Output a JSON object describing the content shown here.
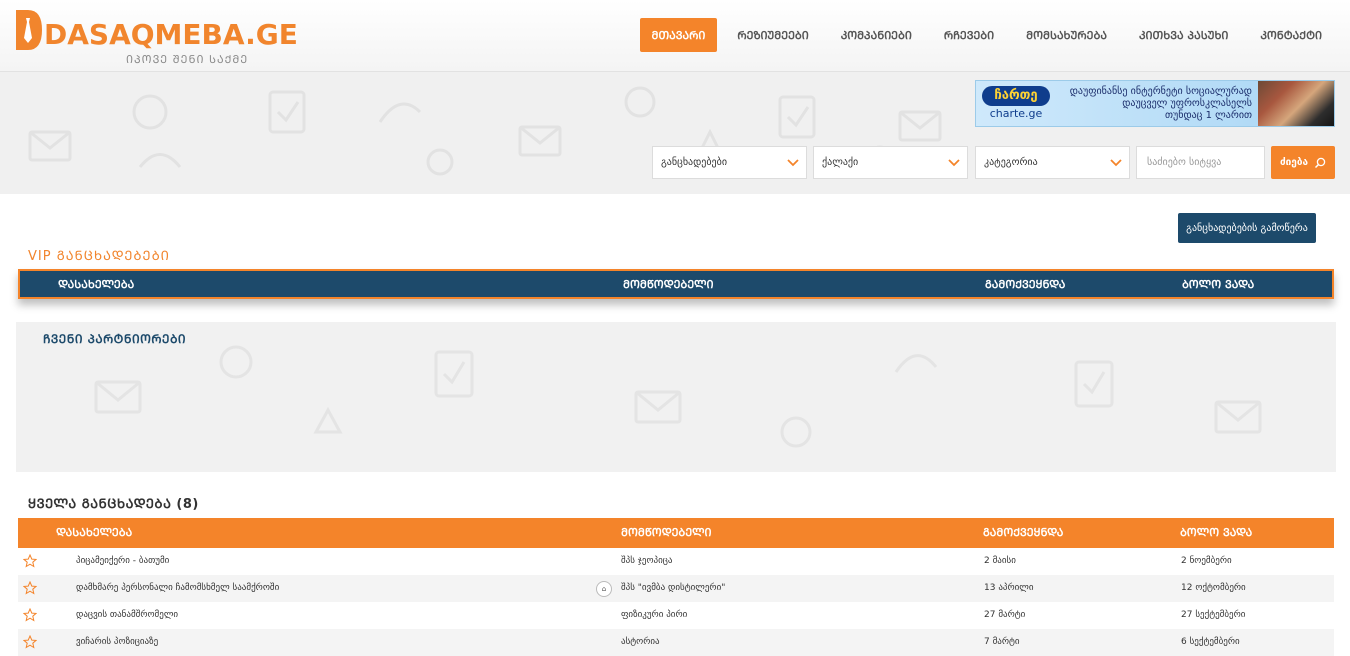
{
  "header": {
    "logo_text": "DASAQMEBA.GE",
    "logo_tagline": "ᲘᲞᲝᲕᲔ ᲨᲔᲜᲘ ᲡᲐᲥᲛᲔ",
    "nav": [
      {
        "label": "ᲛᲗᲐᲕᲐᲠᲘ",
        "active": true
      },
      {
        "label": "ᲠᲔᲖᲘᲣᲛᲔᲔᲑᲘ",
        "active": false
      },
      {
        "label": "ᲙᲝᲛᲞᲐᲜᲘᲔᲑᲘ",
        "active": false
      },
      {
        "label": "ᲠᲩᲔᲕᲔᲑᲘ",
        "active": false
      },
      {
        "label": "ᲛᲝᲛᲡᲐᲮᲣᲠᲔᲑᲐ",
        "active": false
      },
      {
        "label": "ᲙᲘᲗᲮᲕᲐ ᲞᲐᲡᲣᲮᲘ",
        "active": false
      },
      {
        "label": "ᲙᲝᲜᲢᲐᲥᲢᲘ",
        "active": false
      }
    ]
  },
  "banner": {
    "brand": "ჩართე",
    "url": "charte.ge",
    "line1": "დაუფინანსე ინტერნეტი სოციალურად",
    "line2": "დაუცველ უფროსკლასელს",
    "line3": "თუნდაც 1 ლარით"
  },
  "search": {
    "type_select": "განცხადებები",
    "city_select": "ქალაქი",
    "category_select": "კატეგორია",
    "keyword_placeholder": "საძიებო სიტყვა",
    "button_label": "ძიება"
  },
  "export_button": "განცხადებების გამოწერა",
  "vip": {
    "title": "VIP ᲒᲐᲜᲪᲮᲐᲓᲔᲑᲔᲑᲘ",
    "columns": [
      "ᲓᲐᲡᲐᲮᲔᲚᲔᲑᲐ",
      "ᲛᲝᲛᲬᲝᲓᲔᲑᲔᲚᲘ",
      "ᲒᲐᲛᲝᲥᲕᲔᲧᲜᲓᲐ",
      "ᲑᲝᲚᲝ ᲕᲐᲓᲐ"
    ]
  },
  "partners": {
    "title": "ᲩᲕᲔᲜᲘ ᲞᲐᲠᲢᲜᲘᲝᲠᲔᲑᲘ"
  },
  "all": {
    "title": "ᲧᲕᲔᲚᲐ ᲒᲐᲜᲪᲮᲐᲓᲔᲑᲐ (8)",
    "columns": [
      "ᲓᲐᲡᲐᲮᲔᲚᲔᲑᲐ",
      "ᲛᲝᲛᲬᲝᲓᲔᲑᲔᲚᲘ",
      "ᲒᲐᲛᲝᲥᲕᲔᲧᲜᲓᲐ",
      "ᲑᲝᲚᲝ ᲕᲐᲓᲐ"
    ],
    "rows": [
      {
        "title": "პიცამეიქერი - ბათუმი",
        "company": "შპს ჯეოპიცა",
        "published": "2 მაისი",
        "deadline": "2 ნოემბერი"
      },
      {
        "title": "დამხმარე პერსონალი ჩამომსხმელ საამქროში",
        "company": "შპს \"ივმბა დისტილერი\"",
        "published": "13 აპრილი",
        "deadline": "12 ოქტომბერი"
      },
      {
        "title": "დაცვის თანამშრომელი",
        "company": "ფიზიკური პირი",
        "published": "27 მარტი",
        "deadline": "27 სექტემბერი"
      },
      {
        "title": "ვიჩარის პოზიციაზე",
        "company": "ასტორია",
        "published": "7 მარტი",
        "deadline": "6 სექტემბერი"
      }
    ]
  },
  "colors": {
    "accent": "#f4842a",
    "navy": "#1d4a6b"
  }
}
